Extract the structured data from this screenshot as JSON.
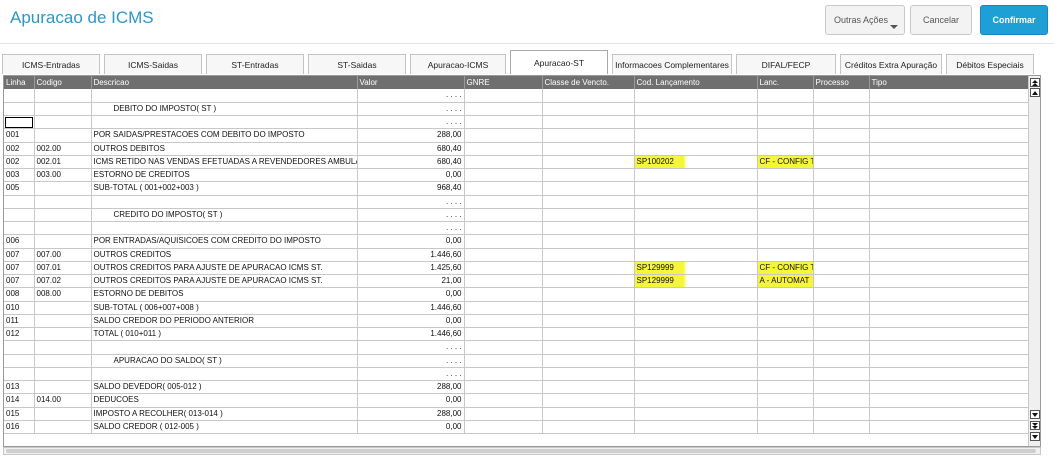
{
  "header": {
    "title": "Apuracao de ICMS",
    "outras_acoes": "Outras Ações",
    "cancelar": "Cancelar",
    "confirmar": "Confirmar"
  },
  "tabs": [
    {
      "label": "ICMS-Entradas",
      "active": false
    },
    {
      "label": "ICMS-Saidas",
      "active": false
    },
    {
      "label": "ST-Entradas",
      "active": false
    },
    {
      "label": "ST-Saidas",
      "active": false
    },
    {
      "label": "Apuracao-ICMS",
      "active": false
    },
    {
      "label": "Apuracao-ST",
      "active": true
    },
    {
      "label": "Informacoes Complementares",
      "active": false
    },
    {
      "label": "DIFAL/FECP",
      "active": false
    },
    {
      "label": "Créditos Extra Apuração",
      "active": false
    },
    {
      "label": "Débitos Especiais",
      "active": false
    }
  ],
  "grid": {
    "columns": [
      "Linha",
      "Codigo",
      "Descricao",
      "Valor",
      "GNRE",
      "Classe de Vencto.",
      "Cod. Lançamento",
      "Lanc.",
      "Processo",
      "Tipo"
    ],
    "rows": [
      {
        "linha": "",
        "codigo": "",
        "descricao": "",
        "valor": ". . . .",
        "gnre": "",
        "classe": "",
        "cod_lanc": "",
        "lanc": "",
        "processo": "",
        "tipo": ""
      },
      {
        "linha": "",
        "codigo": "",
        "descricao": "DEBITO DO IMPOSTO( ST )",
        "valor": ". . . .",
        "gnre": "",
        "classe": "",
        "cod_lanc": "",
        "lanc": "",
        "processo": "",
        "tipo": "",
        "indent": true
      },
      {
        "linha": "",
        "codigo": "",
        "descricao": "",
        "valor": ". . . .",
        "gnre": "",
        "classe": "",
        "cod_lanc": "",
        "lanc": "",
        "processo": "",
        "tipo": "",
        "selected": true
      },
      {
        "linha": "001",
        "codigo": "",
        "descricao": "POR SAIDAS/PRESTACOES COM DEBITO DO IMPOSTO",
        "valor": "288,00",
        "gnre": "",
        "classe": "",
        "cod_lanc": "",
        "lanc": "",
        "processo": "",
        "tipo": ""
      },
      {
        "linha": "002",
        "codigo": "002.00",
        "descricao": "OUTROS DEBITOS",
        "valor": "680,40",
        "gnre": "",
        "classe": "",
        "cod_lanc": "",
        "lanc": "",
        "processo": "",
        "tipo": ""
      },
      {
        "linha": "002",
        "codigo": "002.01",
        "descricao": "ICMS RETIDO NAS VENDAS EFETUADAS A REVENDEDORES AMBULA",
        "valor": "680,40",
        "gnre": "",
        "classe": "",
        "cod_lanc": "SP100202",
        "lanc": "CF - CONFIG T",
        "processo": "",
        "tipo": "",
        "highlight": true
      },
      {
        "linha": "003",
        "codigo": "003.00",
        "descricao": "ESTORNO DE CREDITOS",
        "valor": "0,00",
        "gnre": "",
        "classe": "",
        "cod_lanc": "",
        "lanc": "",
        "processo": "",
        "tipo": ""
      },
      {
        "linha": "005",
        "codigo": "",
        "descricao": "SUB-TOTAL ( 001+002+003 )",
        "valor": "968,40",
        "gnre": "",
        "classe": "",
        "cod_lanc": "",
        "lanc": "",
        "processo": "",
        "tipo": ""
      },
      {
        "linha": "",
        "codigo": "",
        "descricao": "",
        "valor": ". . . .",
        "gnre": "",
        "classe": "",
        "cod_lanc": "",
        "lanc": "",
        "processo": "",
        "tipo": ""
      },
      {
        "linha": "",
        "codigo": "",
        "descricao": "CREDITO DO IMPOSTO( ST )",
        "valor": ". . . .",
        "gnre": "",
        "classe": "",
        "cod_lanc": "",
        "lanc": "",
        "processo": "",
        "tipo": "",
        "indent": true
      },
      {
        "linha": "",
        "codigo": "",
        "descricao": "",
        "valor": ". . . .",
        "gnre": "",
        "classe": "",
        "cod_lanc": "",
        "lanc": "",
        "processo": "",
        "tipo": ""
      },
      {
        "linha": "006",
        "codigo": "",
        "descricao": "POR ENTRADAS/AQUISICOES COM CREDITO DO IMPOSTO",
        "valor": "0,00",
        "gnre": "",
        "classe": "",
        "cod_lanc": "",
        "lanc": "",
        "processo": "",
        "tipo": ""
      },
      {
        "linha": "007",
        "codigo": "007.00",
        "descricao": "OUTROS CREDITOS",
        "valor": "1.446,60",
        "gnre": "",
        "classe": "",
        "cod_lanc": "",
        "lanc": "",
        "processo": "",
        "tipo": ""
      },
      {
        "linha": "007",
        "codigo": "007.01",
        "descricao": "OUTROS CREDITOS PARA AJUSTE DE APURACAO ICMS ST.",
        "valor": "1.425,60",
        "gnre": "",
        "classe": "",
        "cod_lanc": "SP129999",
        "lanc": "CF - CONFIG T",
        "processo": "",
        "tipo": "",
        "highlight": true
      },
      {
        "linha": "007",
        "codigo": "007.02",
        "descricao": "OUTROS CREDITOS PARA AJUSTE DE APURACAO ICMS ST.",
        "valor": "21,00",
        "gnre": "",
        "classe": "",
        "cod_lanc": "SP129999",
        "lanc": "A  - AUTOMAT",
        "processo": "",
        "tipo": "",
        "highlight": true
      },
      {
        "linha": "008",
        "codigo": "008.00",
        "descricao": "ESTORNO DE DEBITOS",
        "valor": "0,00",
        "gnre": "",
        "classe": "",
        "cod_lanc": "",
        "lanc": "",
        "processo": "",
        "tipo": ""
      },
      {
        "linha": "010",
        "codigo": "",
        "descricao": "SUB-TOTAL ( 006+007+008 )",
        "valor": "1.446,60",
        "gnre": "",
        "classe": "",
        "cod_lanc": "",
        "lanc": "",
        "processo": "",
        "tipo": ""
      },
      {
        "linha": "011",
        "codigo": "",
        "descricao": "SALDO CREDOR DO PERIODO ANTERIOR",
        "valor": "0,00",
        "gnre": "",
        "classe": "",
        "cod_lanc": "",
        "lanc": "",
        "processo": "",
        "tipo": ""
      },
      {
        "linha": "012",
        "codigo": "",
        "descricao": "TOTAL ( 010+011 )",
        "valor": "1.446,60",
        "gnre": "",
        "classe": "",
        "cod_lanc": "",
        "lanc": "",
        "processo": "",
        "tipo": ""
      },
      {
        "linha": "",
        "codigo": "",
        "descricao": "",
        "valor": ". . . .",
        "gnre": "",
        "classe": "",
        "cod_lanc": "",
        "lanc": "",
        "processo": "",
        "tipo": ""
      },
      {
        "linha": "",
        "codigo": "",
        "descricao": "APURACAO DO SALDO( ST )",
        "valor": ". . . .",
        "gnre": "",
        "classe": "",
        "cod_lanc": "",
        "lanc": "",
        "processo": "",
        "tipo": "",
        "indent": true
      },
      {
        "linha": "",
        "codigo": "",
        "descricao": "",
        "valor": ". . . .",
        "gnre": "",
        "classe": "",
        "cod_lanc": "",
        "lanc": "",
        "processo": "",
        "tipo": ""
      },
      {
        "linha": "013",
        "codigo": "",
        "descricao": "SALDO DEVEDOR( 005-012 )",
        "valor": "288,00",
        "gnre": "",
        "classe": "",
        "cod_lanc": "",
        "lanc": "",
        "processo": "",
        "tipo": ""
      },
      {
        "linha": "014",
        "codigo": "014.00",
        "descricao": "DEDUCOES",
        "valor": "0,00",
        "gnre": "",
        "classe": "",
        "cod_lanc": "",
        "lanc": "",
        "processo": "",
        "tipo": ""
      },
      {
        "linha": "015",
        "codigo": "",
        "descricao": "IMPOSTO A RECOLHER( 013-014 )",
        "valor": "288,00",
        "gnre": "",
        "classe": "",
        "cod_lanc": "",
        "lanc": "",
        "processo": "",
        "tipo": ""
      },
      {
        "linha": "016",
        "codigo": "",
        "descricao": "SALDO CREDOR ( 012-005 )",
        "valor": "0,00",
        "gnre": "",
        "classe": "",
        "cod_lanc": "",
        "lanc": "",
        "processo": "",
        "tipo": ""
      }
    ]
  },
  "colors": {
    "title": "#2c97c9",
    "confirm": "#1ea0d6",
    "header_row": "#6f6f6f",
    "highlight": "#f5f53a"
  },
  "icons": {
    "scroll_top": "double-arrow-up-icon",
    "scroll_up": "arrow-up-icon",
    "scroll_down": "arrow-down-icon",
    "scroll_bottom": "double-arrow-down-icon"
  }
}
